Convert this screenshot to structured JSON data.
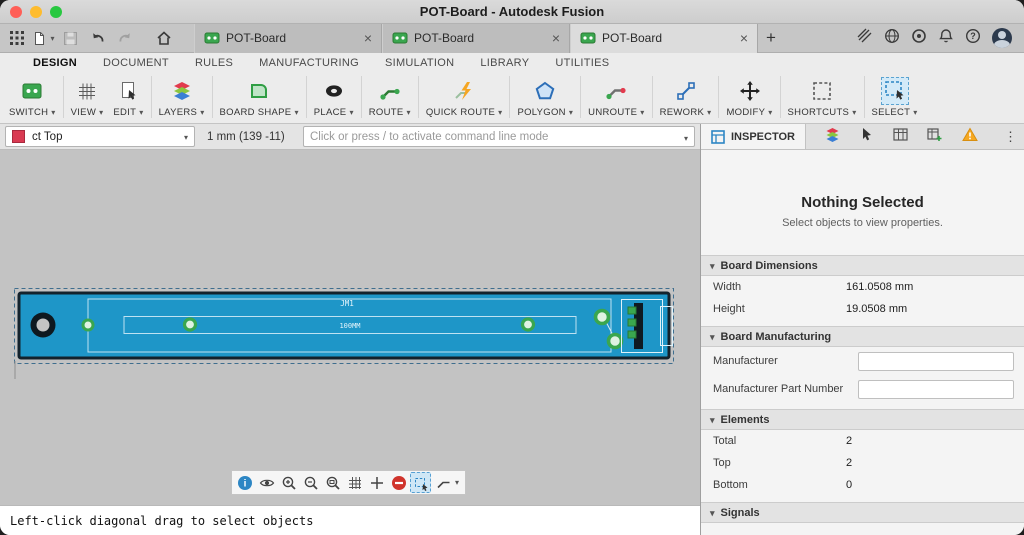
{
  "titlebar": {
    "title": "POT-Board - Autodesk Fusion"
  },
  "tabbar": {
    "new_tab": "+",
    "tabs": [
      {
        "label": "POT-Board"
      },
      {
        "label": "POT-Board"
      },
      {
        "label": "POT-Board"
      }
    ]
  },
  "menubar": {
    "items": [
      {
        "label": "DESIGN"
      },
      {
        "label": "DOCUMENT"
      },
      {
        "label": "RULES"
      },
      {
        "label": "MANUFACTURING"
      },
      {
        "label": "SIMULATION"
      },
      {
        "label": "LIBRARY"
      },
      {
        "label": "UTILITIES"
      }
    ]
  },
  "toolbar": {
    "groups": [
      {
        "label": "SWITCH",
        "icon": "switch-board-icon"
      },
      {
        "label": "VIEW",
        "icon": "view-grid-icon"
      },
      {
        "label": "EDIT",
        "icon": "edit-document-icon"
      },
      {
        "label": "LAYERS",
        "icon": "layers-stack-icon"
      },
      {
        "label": "BOARD SHAPE",
        "icon": "board-shape-icon"
      },
      {
        "label": "PLACE",
        "icon": "place-pad-icon"
      },
      {
        "label": "ROUTE",
        "icon": "route-trace-icon"
      },
      {
        "label": "QUICK ROUTE",
        "icon": "quick-route-lightning-icon"
      },
      {
        "label": "POLYGON",
        "icon": "polygon-icon"
      },
      {
        "label": "UNROUTE",
        "icon": "unroute-trace-icon"
      },
      {
        "label": "REWORK",
        "icon": "rework-icon"
      },
      {
        "label": "MODIFY",
        "icon": "modify-move-icon"
      },
      {
        "label": "SHORTCUTS",
        "icon": "shortcuts-marquee-icon"
      },
      {
        "label": "SELECT",
        "icon": "select-marquee-icon",
        "active": true
      }
    ]
  },
  "commandbar": {
    "layer_selector": {
      "value": "ct Top",
      "swatch_color": "#d93a52"
    },
    "coordinates": "1 mm (139 -11)",
    "command_input_placeholder": "Click or press / to activate command line mode"
  },
  "canvas": {
    "board": {
      "label_designator": "JM1",
      "label_dimension": "100MM",
      "board_color": "#1e96c8",
      "pad_color": "#3aa64f",
      "selected": true
    }
  },
  "view_toolbar": {
    "buttons": [
      "info",
      "layer-visibility",
      "zoom-in",
      "zoom-out",
      "zoom-window",
      "grid-settings",
      "origin-crosshair",
      "delete-restrict",
      "marquee-select",
      "bend-style"
    ],
    "active_button": "marquee-select"
  },
  "inspector": {
    "tab_label": "INSPECTOR",
    "empty_state": {
      "title": "Nothing Selected",
      "subtitle": "Select objects to view properties."
    },
    "board_dimensions": {
      "title": "Board Dimensions",
      "rows": [
        {
          "label": "Width",
          "value": "161.0508 mm"
        },
        {
          "label": "Height",
          "value": "19.0508 mm"
        }
      ]
    },
    "board_manufacturing": {
      "title": "Board Manufacturing",
      "fields": [
        {
          "label": "Manufacturer",
          "value": ""
        },
        {
          "label": "Manufacturer Part Number",
          "value": ""
        }
      ]
    },
    "elements": {
      "title": "Elements",
      "rows": [
        {
          "label": "Total",
          "value": "2"
        },
        {
          "label": "Top",
          "value": "2"
        },
        {
          "label": "Bottom",
          "value": "0"
        }
      ]
    },
    "signals": {
      "title": "Signals"
    }
  },
  "statusbar": {
    "message": "Left-click diagonal drag to select objects"
  }
}
